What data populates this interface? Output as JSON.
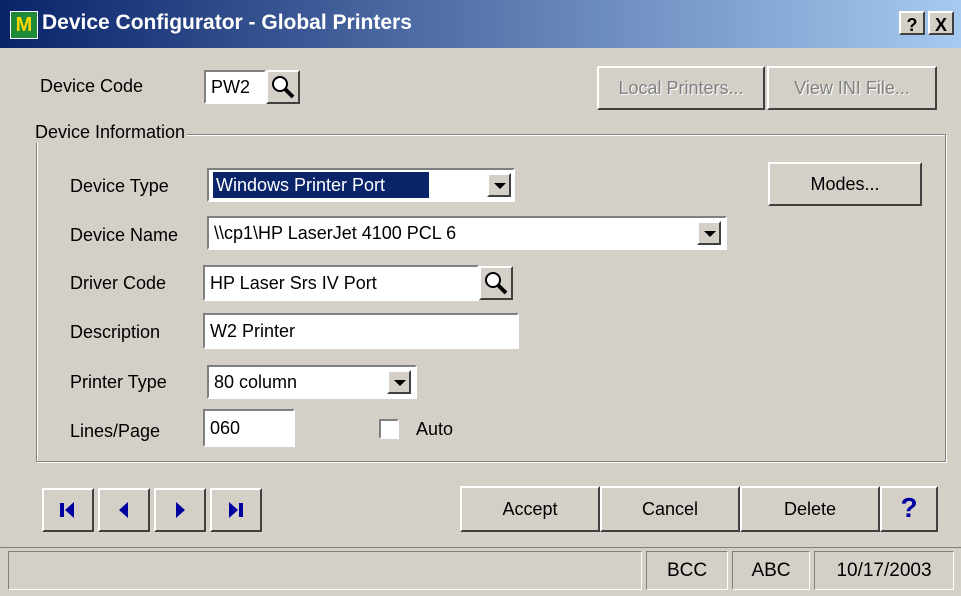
{
  "window": {
    "title": "Device Configurator - Global Printers",
    "app_icon_letter": "M",
    "help_button": "?",
    "close_button": "X"
  },
  "device_code": {
    "label": "Device Code",
    "value": "PW2"
  },
  "top_buttons": {
    "local_printers": "Local Printers...",
    "view_ini": "View INI File..."
  },
  "group": {
    "title": "Device Information",
    "modes_button": "Modes...",
    "device_type": {
      "label": "Device Type",
      "value": "Windows Printer Port"
    },
    "device_name": {
      "label": "Device Name",
      "value": "\\\\cp1\\HP LaserJet 4100 PCL 6"
    },
    "driver_code": {
      "label": "Driver Code",
      "value": "HP Laser Srs IV Port"
    },
    "description": {
      "label": "Description",
      "value": "W2 Printer"
    },
    "printer_type": {
      "label": "Printer Type",
      "value": "80 column"
    },
    "lines_page": {
      "label": "Lines/Page",
      "value": "060"
    },
    "auto": {
      "label": "Auto",
      "checked": false
    }
  },
  "footer_buttons": {
    "accept": "Accept",
    "cancel": "Cancel",
    "delete": "Delete",
    "help": "?"
  },
  "status_bar": {
    "panel1": "",
    "company": "BCC",
    "user": "ABC",
    "date": "10/17/2003"
  },
  "colors": {
    "titlebar_start": "#0a246a",
    "titlebar_end": "#a6caf0",
    "selection": "#0a246a",
    "nav_blue": "#0000a0"
  }
}
